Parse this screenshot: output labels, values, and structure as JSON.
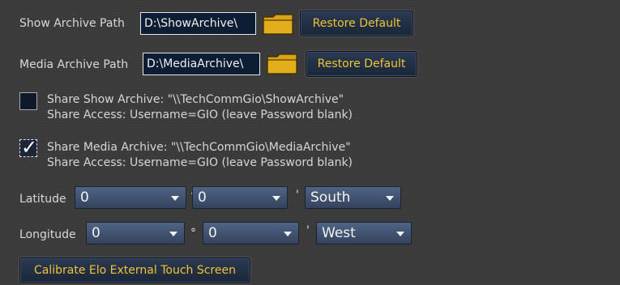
{
  "show_archive": {
    "label": "Show Archive Path",
    "path": "D:\\ShowArchive\\",
    "folder_icon": "folder-icon",
    "restore_label": "Restore Default"
  },
  "media_archive": {
    "label": "Media Archive Path",
    "path": "D:\\MediaArchive\\",
    "folder_icon": "folder-icon",
    "restore_label": "Restore Default"
  },
  "share_show": {
    "checked": false,
    "line1": "Share Show Archive: \"\\\\TechCommGio\\ShowArchive\"",
    "line2": "Share Access: Username=GIO (leave Password blank)"
  },
  "share_media": {
    "checked": true,
    "line1": "Share Media Archive: \"\\\\TechCommGio\\MediaArchive\"",
    "line2": "Share Access: Username=GIO (leave Password blank)"
  },
  "latitude": {
    "label": "Latitude",
    "degrees": "0",
    "degree_symbol": "°",
    "minutes": "0",
    "minute_symbol": "'",
    "direction": "South"
  },
  "longitude": {
    "label": "Longitude",
    "degrees": "0",
    "degree_symbol": "°",
    "minutes": "0",
    "minute_symbol": "'",
    "direction": "West"
  },
  "calibrate_label": "Calibrate Elo External Touch Screen",
  "colors": {
    "button_text": "#f3c232",
    "dropdown_bg": "#4f6384",
    "path_bg": "#0d1d33"
  }
}
